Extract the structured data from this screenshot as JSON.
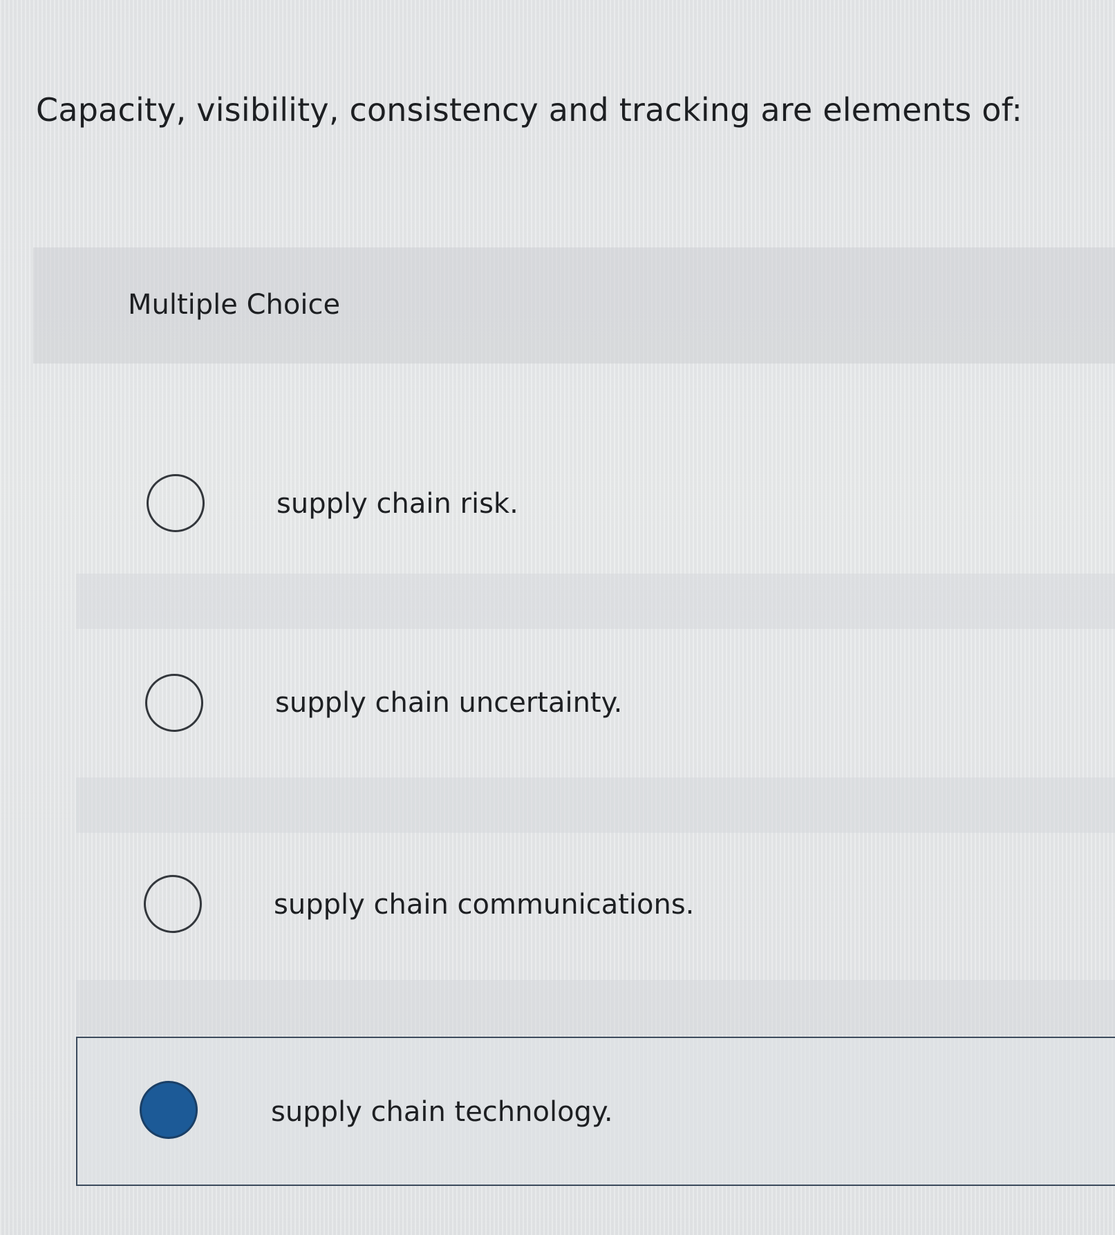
{
  "question": {
    "text": "Capacity, visibility, consistency and tracking are elements of:"
  },
  "answer_section": {
    "label": "Multiple Choice"
  },
  "options": [
    {
      "text": "supply chain risk.",
      "selected": false
    },
    {
      "text": "supply chain uncertainty.",
      "selected": false
    },
    {
      "text": "supply chain communications.",
      "selected": false
    },
    {
      "text": "supply chain technology.",
      "selected": true
    }
  ],
  "colors": {
    "selected_radio_fill": "#1c5a97",
    "selected_border": "#3b4a5c",
    "text": "#1d1f22",
    "background": "#e4e6e8"
  }
}
